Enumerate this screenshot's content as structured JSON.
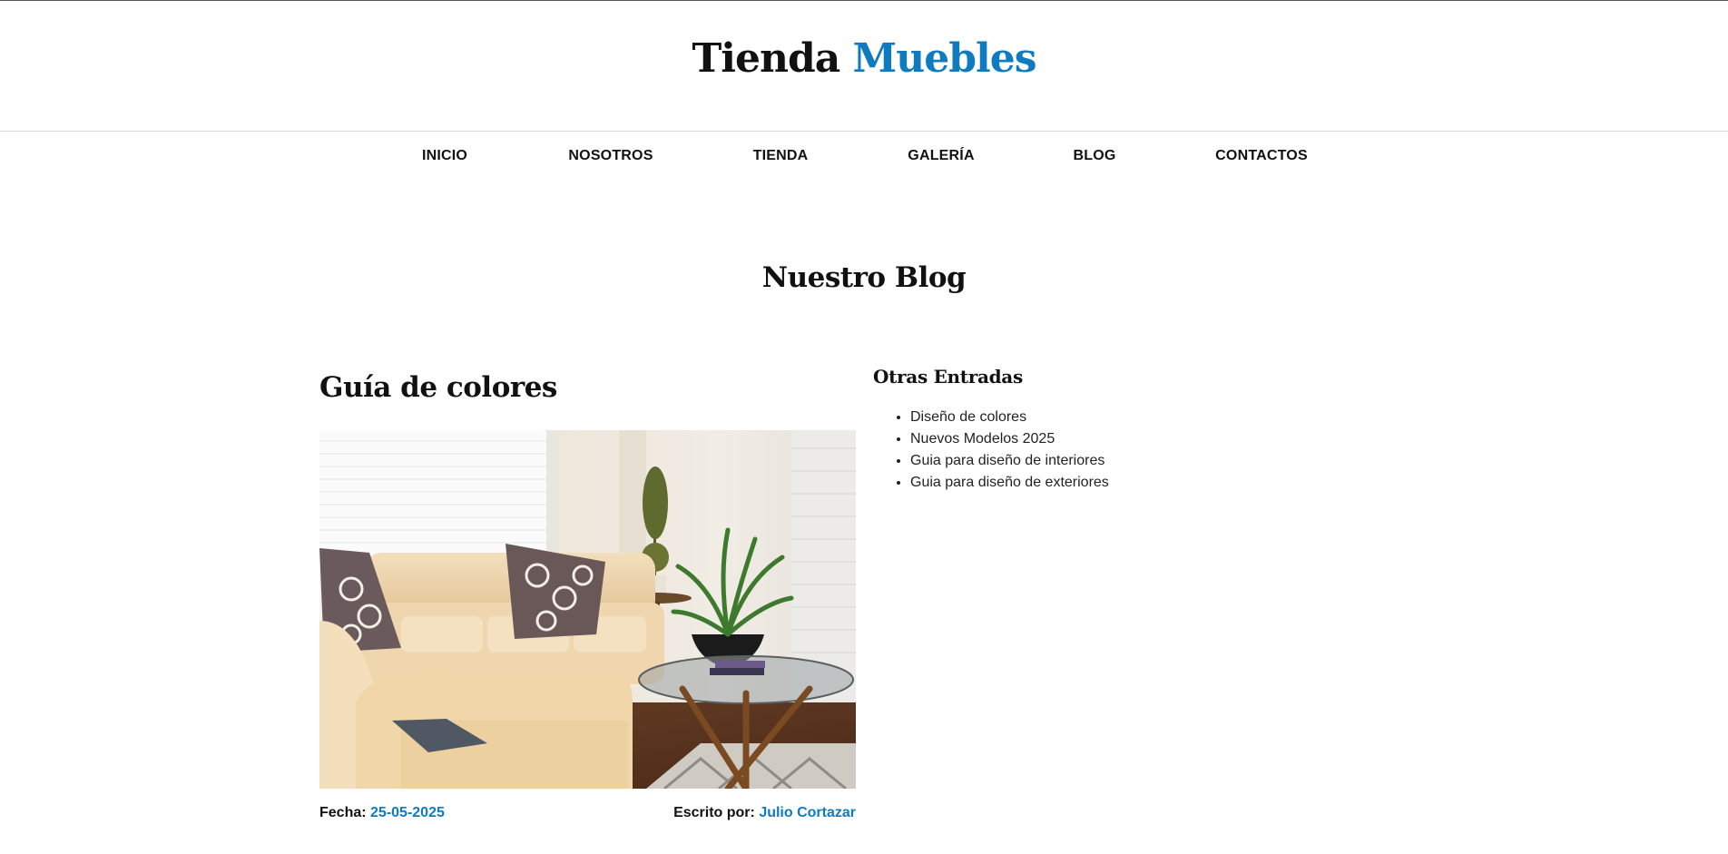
{
  "header": {
    "title_main": "Tienda",
    "title_accent": "Muebles",
    "accent_color": "#0e7bc0"
  },
  "nav": {
    "items": [
      {
        "label": "INICIO"
      },
      {
        "label": "NOSOTROS"
      },
      {
        "label": "TIENDA"
      },
      {
        "label": "GALERÍA"
      },
      {
        "label": "BLOG"
      },
      {
        "label": "CONTACTOS"
      }
    ]
  },
  "page": {
    "heading": "Nuestro Blog"
  },
  "post": {
    "title": "Guía de colores",
    "image_icon": "living-room-photo",
    "date_label": "Fecha:",
    "date_value": "25-05-2025",
    "author_label": "Escrito por:",
    "author_value": "Julio Cortazar"
  },
  "sidebar": {
    "title": "Otras Entradas",
    "items": [
      {
        "label": "Diseño de colores"
      },
      {
        "label": "Nuevos Modelos 2025"
      },
      {
        "label": "Guia para diseño de interiores"
      },
      {
        "label": "Guia para diseño de exteriores"
      }
    ]
  }
}
